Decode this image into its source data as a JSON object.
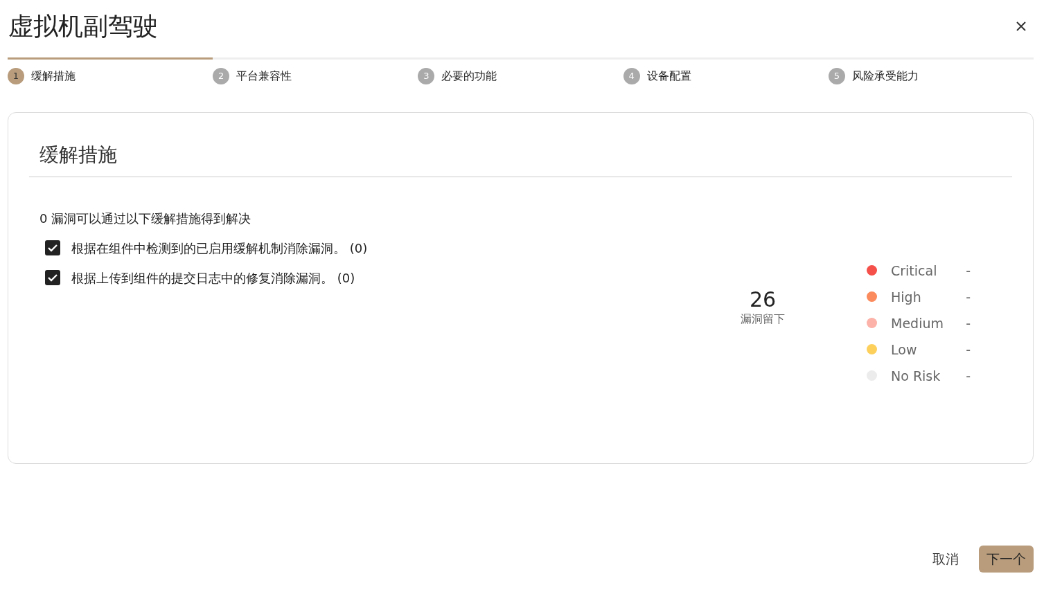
{
  "window": {
    "title": "虚拟机副驾驶"
  },
  "steps": [
    {
      "number": "1",
      "label": "缓解措施",
      "selected": true
    },
    {
      "number": "2",
      "label": "平台兼容性",
      "selected": false
    },
    {
      "number": "3",
      "label": "必要的功能",
      "selected": false
    },
    {
      "number": "4",
      "label": "设备配置",
      "selected": false
    },
    {
      "number": "5",
      "label": "风险承受能力",
      "selected": false
    }
  ],
  "panel": {
    "title": "缓解措施",
    "summary": "0 漏洞可以通过以下缓解措施得到解决",
    "options": [
      {
        "label": "根据在组件中检测到的已启用缓解机制消除漏洞。 (0)",
        "checked": true
      },
      {
        "label": "根据上传到组件的提交日志中的修复消除漏洞。 (0)",
        "checked": true
      }
    ],
    "remaining": {
      "count": "26",
      "label": "漏洞留下"
    },
    "legend": [
      {
        "label": "Critical",
        "value": "-",
        "color": "#f5504a"
      },
      {
        "label": "High",
        "value": "-",
        "color": "#fb8a5c"
      },
      {
        "label": "Medium",
        "value": "-",
        "color": "#fcb2a8"
      },
      {
        "label": "Low",
        "value": "-",
        "color": "#fdd05c"
      },
      {
        "label": "No Risk",
        "value": "-",
        "color": "#ececec"
      }
    ]
  },
  "buttons": {
    "cancel": "取消",
    "next": "下一个"
  }
}
